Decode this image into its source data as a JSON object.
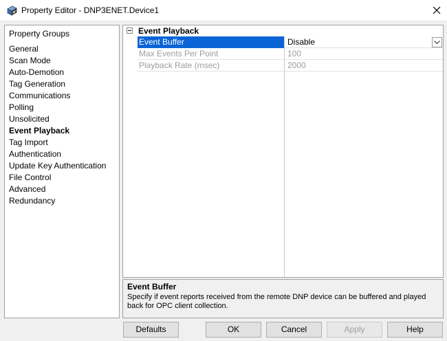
{
  "window": {
    "title": "Property Editor - DNP3ENET.Device1",
    "icon": "property-editor-app-icon",
    "close_icon": "close-icon"
  },
  "tree": {
    "root_label": "Property Groups",
    "items": [
      {
        "label": "General",
        "selected": false
      },
      {
        "label": "Scan Mode",
        "selected": false
      },
      {
        "label": "Auto-Demotion",
        "selected": false
      },
      {
        "label": "Tag Generation",
        "selected": false
      },
      {
        "label": "Communications",
        "selected": false
      },
      {
        "label": "Polling",
        "selected": false
      },
      {
        "label": "Unsolicited",
        "selected": false
      },
      {
        "label": "Event Playback",
        "selected": true
      },
      {
        "label": "Tag Import",
        "selected": false
      },
      {
        "label": "Authentication",
        "selected": false
      },
      {
        "label": "Update Key Authentication",
        "selected": false
      },
      {
        "label": "File Control",
        "selected": false
      },
      {
        "label": "Advanced",
        "selected": false
      },
      {
        "label": "Redundancy",
        "selected": false
      }
    ]
  },
  "grid": {
    "category": "Event Playback",
    "category_toggle_icon": "collapse-minus-icon",
    "rows": [
      {
        "name": "Event Buffer",
        "value": "Disable",
        "selected": true,
        "disabled": false,
        "dropdown": true
      },
      {
        "name": "Max Events Per Point",
        "value": "100",
        "selected": false,
        "disabled": true,
        "dropdown": false
      },
      {
        "name": "Playback Rate (msec)",
        "value": "2000",
        "selected": false,
        "disabled": true,
        "dropdown": false
      }
    ]
  },
  "description": {
    "title": "Event Buffer",
    "text": "Specify if event reports received from the remote DNP device can be buffered and played back for OPC client collection."
  },
  "buttons": {
    "defaults": "Defaults",
    "ok": "OK",
    "cancel": "Cancel",
    "apply": "Apply",
    "help": "Help"
  },
  "colors": {
    "selection": "#0a64d6",
    "disabled_text": "#9c9c9c"
  }
}
